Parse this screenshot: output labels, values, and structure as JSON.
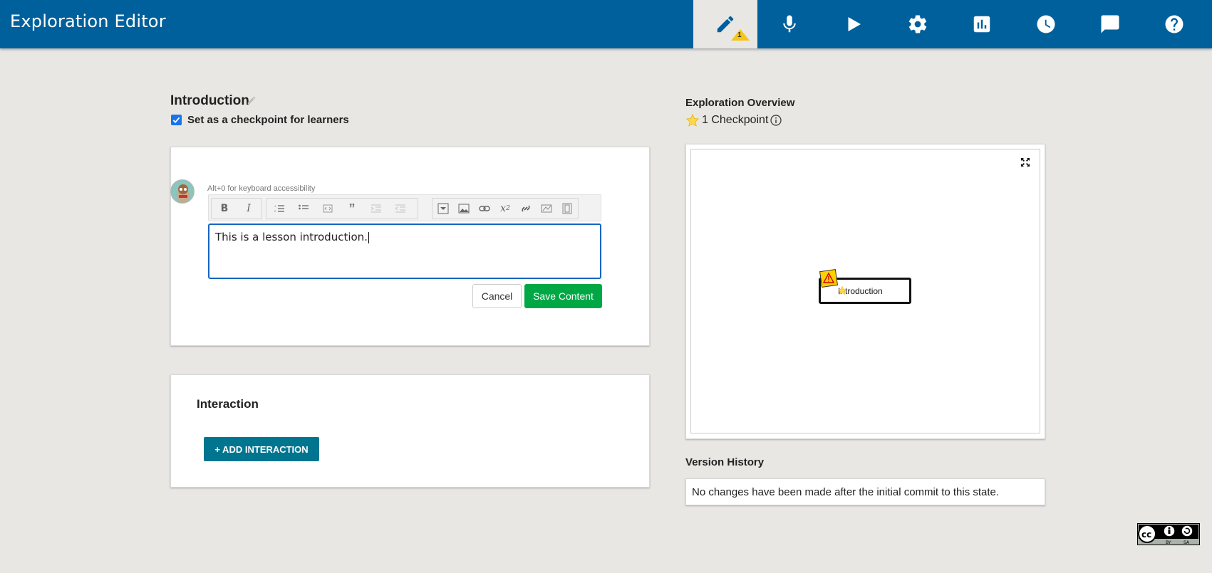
{
  "header": {
    "title": "Exploration Editor",
    "nav": [
      {
        "name": "editor",
        "icon": "pencil-icon",
        "active": true,
        "warning_count": "1"
      },
      {
        "name": "translation",
        "icon": "microphone-icon"
      },
      {
        "name": "preview",
        "icon": "play-icon"
      },
      {
        "name": "settings",
        "icon": "gear-icon"
      },
      {
        "name": "statistics",
        "icon": "bar-chart-icon"
      },
      {
        "name": "history",
        "icon": "clock-icon"
      },
      {
        "name": "feedback",
        "icon": "comment-icon"
      },
      {
        "name": "help",
        "icon": "help-icon"
      }
    ]
  },
  "state": {
    "title": "Introduction",
    "checkpoint_label": "Set as a checkpoint for learners",
    "checkpoint_checked": true
  },
  "editor": {
    "hint": "Alt+0 for keyboard accessibility",
    "content": "This is a lesson introduction.",
    "cancel_label": "Cancel",
    "save_label": "Save Content",
    "toolbar": [
      "bold",
      "italic",
      "numbered-list",
      "bulleted-list",
      "code",
      "blockquote",
      "indent",
      "outdent",
      "collapsible",
      "image",
      "link",
      "math",
      "skill-review",
      "svg-editor",
      "video"
    ]
  },
  "interaction": {
    "title": "Interaction",
    "add_label": "+ ADD INTERACTION"
  },
  "overview": {
    "title": "Exploration Overview",
    "checkpoint_summary": "1 Checkpoint",
    "node_label": "Introduction"
  },
  "version_history": {
    "title": "Version History",
    "message": "No changes have been made after the initial commit to this state."
  },
  "colors": {
    "header_bg": "#00609c",
    "save_green": "#00a845",
    "interaction_teal": "#00758f",
    "checkbox_blue": "#1a73e8"
  }
}
